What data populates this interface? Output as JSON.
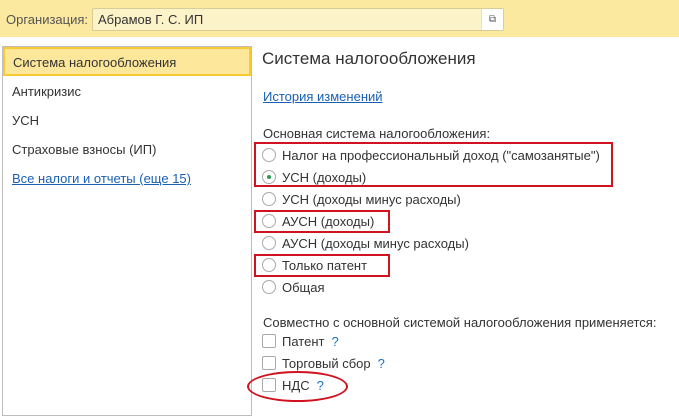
{
  "header": {
    "org_label": "Организация:",
    "org_value": "Абрамов Г. С. ИП",
    "open_icon": "open-window-icon"
  },
  "sidebar": {
    "items": [
      {
        "label": "Система налогообложения"
      },
      {
        "label": "Антикризис"
      },
      {
        "label": "УСН"
      },
      {
        "label": "Страховые взносы (ИП)"
      }
    ],
    "all_link": "Все налоги и отчеты (еще 15)"
  },
  "main": {
    "title": "Система налогообложения",
    "history_link": "История изменений",
    "main_system_label": "Основная система налогообложения:",
    "options": [
      {
        "label": "Налог на профессиональный доход (\"самозанятые\")",
        "selected": false
      },
      {
        "label": "УСН (доходы)",
        "selected": true
      },
      {
        "label": "УСН (доходы минус расходы)",
        "selected": false
      },
      {
        "label": "АУСН (доходы)",
        "selected": false
      },
      {
        "label": "АУСН (доходы минус расходы)",
        "selected": false
      },
      {
        "label": "Только патент",
        "selected": false
      },
      {
        "label": "Общая",
        "selected": false
      }
    ],
    "combined_label": "Совместно с основной системой налогообложения применяется:",
    "checkboxes": [
      {
        "label": "Патент",
        "checked": false,
        "help": "?"
      },
      {
        "label": "Торговый сбор",
        "checked": false,
        "help": "?"
      },
      {
        "label": "НДС",
        "checked": false,
        "help": "?"
      }
    ]
  },
  "colors": {
    "highlight": "#d0131f",
    "header_bg": "#fbe9a0",
    "link": "#1a5fb4"
  }
}
